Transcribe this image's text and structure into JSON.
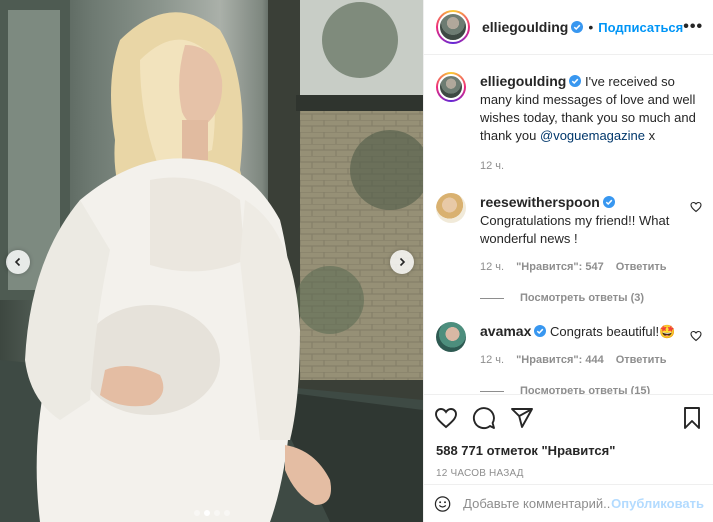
{
  "post": {
    "author": "elliegoulding",
    "follow_label": "Подписаться",
    "separator": "•",
    "more_label": "•••",
    "caption": "I've received so many kind messages of love and well wishes today, thank you so much and thank you ",
    "caption_mention": "@voguemagazine",
    "caption_end": " x",
    "caption_time": "12 ч.",
    "slides_count": 4,
    "active_slide": 1
  },
  "comments": [
    {
      "user": "reesewitherspoon",
      "text": "Congratulations my friend!! What wonderful news !",
      "time": "12 ч.",
      "likes": "\"Нравится\": 547",
      "reply_label": "Ответить",
      "view_replies": "Посмотреть ответы (3)"
    },
    {
      "user": "avamax",
      "text": "Congrats beautiful!🤩",
      "time": "12 ч.",
      "likes": "\"Нравится\": 444",
      "reply_label": "Ответить",
      "view_replies": "Посмотреть ответы (15)"
    }
  ],
  "stats": {
    "likes": "588 771 отметок \"Нравится\"",
    "time_ago": "12 ЧАСОВ НАЗАД"
  },
  "add_comment": {
    "placeholder": "Добавьте комментарий...",
    "publish_label": "Опубликовать"
  },
  "icons": {
    "verified": "verified-badge-icon",
    "like": "heart-icon",
    "comment": "comment-icon",
    "share": "paper-plane-icon",
    "save": "bookmark-icon",
    "emoji": "smiley-icon"
  },
  "colors": {
    "link_blue": "#0095f6",
    "mention_blue": "#00376b",
    "muted": "#8e8e8e",
    "border": "#efefef"
  }
}
